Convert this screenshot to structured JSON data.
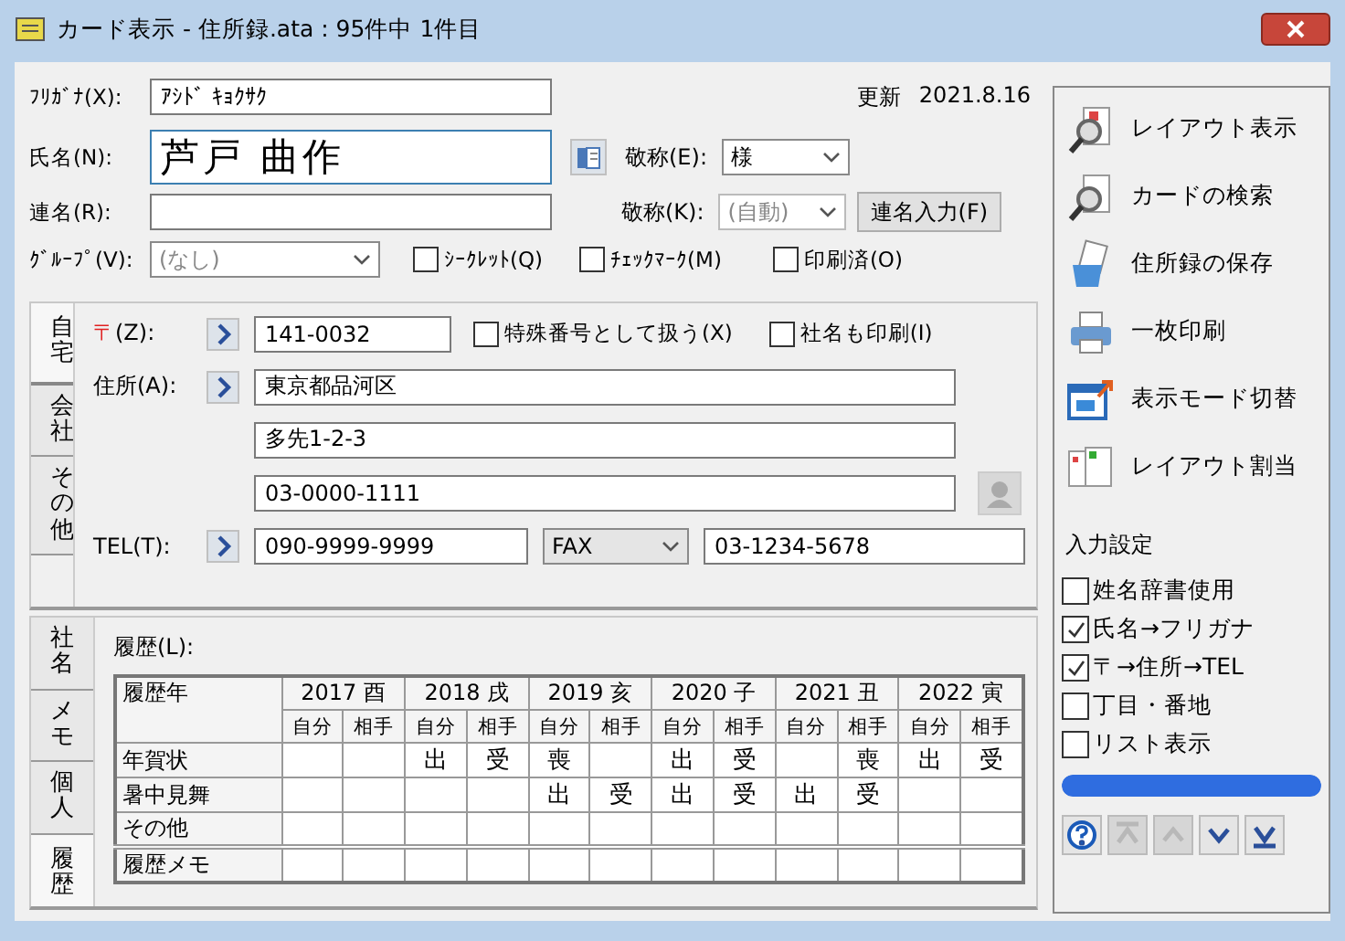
{
  "window": {
    "title": "カード表示 - 住所録.ata : 95件中 1件目"
  },
  "updated": {
    "label": "更新",
    "date": "2021.8.16"
  },
  "furigana": {
    "label": "ﾌﾘｶﾞﾅ(X):",
    "value": "ｱｼﾄﾞ ｷｮｸｻｸ"
  },
  "name": {
    "label": "氏名(N):",
    "value": "芦戸 曲作"
  },
  "honorific": {
    "label": "敬称(E):",
    "value": "様"
  },
  "joint_name": {
    "label": "連名(R):"
  },
  "joint_honorific": {
    "label": "敬称(K):",
    "value": "(自動)",
    "disabled": true
  },
  "joint_button": "連名入力(F)",
  "group": {
    "label": "ｸﾞﾙｰﾌﾟ(V):",
    "value": "(なし)"
  },
  "flags": [
    {
      "label": "ｼｰｸﾚｯﾄ(Q)",
      "checked": false
    },
    {
      "label": "ﾁｪｯｸﾏｰｸ(M)",
      "checked": false
    },
    {
      "label": "印刷済(O)",
      "checked": false
    }
  ],
  "address_tabs": [
    {
      "label": "自宅",
      "selected": true
    },
    {
      "label": "会社",
      "selected": false
    },
    {
      "label": "その他",
      "selected": false
    }
  ],
  "address": {
    "postal_mark": "〒",
    "postal_label": "(Z):",
    "postal": "141-0032",
    "options": [
      {
        "label": "特殊番号として扱う(X)",
        "checked": false
      },
      {
        "label": "社名も印刷(I)",
        "checked": false
      }
    ],
    "address_label": "住所(A):",
    "lines": [
      "東京都品河区",
      "多先1-2-3",
      "03-0000-1111"
    ],
    "tel_label": "TEL(T):",
    "tel": "090-9999-9999",
    "tel2_type": "FAX",
    "tel2": "03-1234-5678"
  },
  "history_tabs": [
    {
      "label": "社名",
      "selected": false
    },
    {
      "label": "メモ",
      "selected": false
    },
    {
      "label": "個人",
      "selected": false
    },
    {
      "label": "履歴",
      "selected": true
    }
  ],
  "history": {
    "label": "履歴(L):",
    "corner": "履歴年",
    "years": [
      {
        "label": "2017 酉",
        "mine": "自分",
        "theirs": "相手"
      },
      {
        "label": "2018 戌",
        "mine": "自分",
        "theirs": "相手"
      },
      {
        "label": "2019 亥",
        "mine": "自分",
        "theirs": "相手"
      },
      {
        "label": "2020 子",
        "mine": "自分",
        "theirs": "相手"
      },
      {
        "label": "2021 丑",
        "mine": "自分",
        "theirs": "相手"
      },
      {
        "label": "2022 寅",
        "mine": "自分",
        "theirs": "相手"
      }
    ],
    "rows": [
      {
        "label": "年賀状",
        "cells": [
          null,
          null,
          "出",
          "受",
          "喪",
          null,
          "出",
          "受",
          null,
          "喪",
          "出",
          "受"
        ]
      },
      {
        "label": "暑中見舞",
        "cells": [
          null,
          null,
          null,
          null,
          "出",
          "受",
          "出",
          "受",
          "出",
          "受",
          null,
          null
        ]
      },
      {
        "label": "その他",
        "cells": [
          null,
          null,
          null,
          null,
          null,
          null,
          null,
          null,
          null,
          null,
          null,
          null
        ]
      },
      {
        "label": "履歴メモ",
        "cells": [
          null,
          null,
          null,
          null,
          null,
          null,
          null,
          null,
          null,
          null,
          null,
          null
        ]
      }
    ]
  },
  "actions": [
    {
      "kind": "layout-view",
      "label": "レイアウト表示"
    },
    {
      "kind": "search",
      "label": "カードの検索"
    },
    {
      "kind": "save",
      "label": "住所録の保存"
    },
    {
      "kind": "print",
      "label": "一枚印刷"
    },
    {
      "kind": "mode",
      "label": "表示モード切替"
    },
    {
      "kind": "assign",
      "label": "レイアウト割当"
    }
  ],
  "input_settings": {
    "title": "入力設定",
    "options": [
      {
        "label": "姓名辞書使用",
        "checked": false
      },
      {
        "label": "氏名→フリガナ",
        "checked": true
      },
      {
        "label": "〒→住所→TEL",
        "checked": true
      },
      {
        "label": "丁目・番地",
        "checked": false
      },
      {
        "label": "リスト表示",
        "checked": false
      }
    ]
  },
  "progress": {
    "level": 1
  },
  "nav": [
    {
      "kind": "help",
      "disabled": false
    },
    {
      "kind": "first",
      "disabled": true
    },
    {
      "kind": "prev",
      "disabled": true
    },
    {
      "kind": "next",
      "disabled": false
    },
    {
      "kind": "last",
      "disabled": false
    }
  ]
}
